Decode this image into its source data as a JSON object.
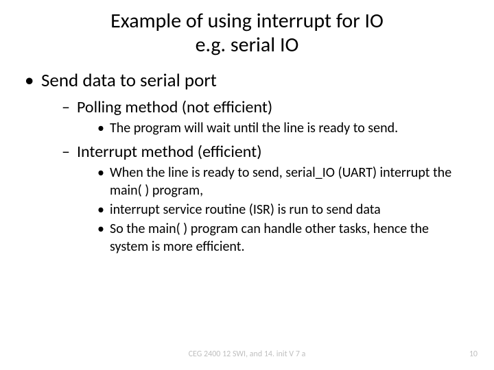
{
  "title_line1": "Example of using interrupt for IO",
  "title_line2": "e.g. serial IO",
  "bullets": {
    "l1": "Send data to serial port",
    "l2a": "Polling method (not efficient)",
    "l3a1": "The program will wait until the line is ready to send.",
    "l2b": "Interrupt method (efficient)",
    "l3b1": "When the line is ready to send, serial_IO (UART) interrupt the  main( )  program,",
    "l3b2": "interrupt service routine (ISR) is run to send data",
    "l3b3": "So the main( ) program can handle other tasks, hence the system is more efficient."
  },
  "footer": {
    "center": "CEG 2400 12 SWI, and 14. init V 7 a",
    "page": "10"
  }
}
